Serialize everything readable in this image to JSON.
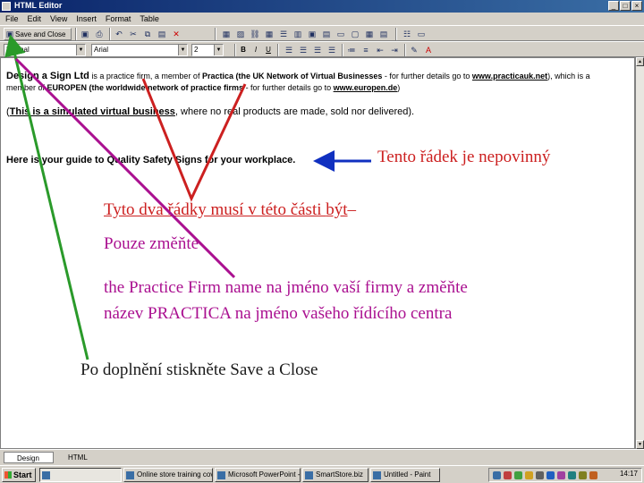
{
  "window": {
    "title": "HTML Editor",
    "buttons": {
      "minimize": "_",
      "maximize": "□",
      "close": "×"
    }
  },
  "menu": [
    "File",
    "Edit",
    "View",
    "Insert",
    "Format",
    "Table"
  ],
  "toolbar1": {
    "save_close_label": "Save and Close"
  },
  "toolbar2": {
    "style_value": "Normal",
    "font_value": "Arial",
    "size_value": "2",
    "bold": "B",
    "italic": "I",
    "underline": "U"
  },
  "document": {
    "para1_company": "Design a Sign Ltd",
    "para1_text1": " is a practice firm, a member of ",
    "para1_practica": "Practica (the UK Network of Virtual Businesses",
    "para1_text2": " - for further details go to ",
    "para1_link1": "www.practicauk.net",
    "para1_text3": "), which is a",
    "para2_text1": "member of ",
    "para2_europen": "EUROPEN (the worldwide network of practice firms",
    "para2_text2": " - for further details go to ",
    "para2_link2": "www.europen.de",
    "para2_text3": ")",
    "para3_open": "(",
    "para3_bold": "This is a simulated virtual business",
    "para3_mid": ", where no real products are made, sold nor delivered",
    "para3_close": ").",
    "guide_line": "Here is your guide to Quality Safety Signs for your workplace."
  },
  "annotations": {
    "optional_note": "Tento řádek je nepovinný",
    "required_prefix": "Tyto dva řádky musí v této části ",
    "required_word": "být",
    "required_suffix": "–",
    "only_change": "Pouze změňte",
    "change_line1": "the Practice Firm name  na jméno vaší firmy a změňte",
    "change_line2": "název PRACTICA  na jméno vašeho řídícího centra",
    "after_fill": "Po doplnění stiskněte Save a Close"
  },
  "view_tabs": {
    "design": "Design",
    "html": "HTML"
  },
  "taskbar": {
    "start": "Start",
    "tasks": [
      "Online store training cov",
      "Microsoft PowerPoint - ...",
      "SmartStore.biz",
      "Untitled - Paint"
    ],
    "clock": "14:17"
  },
  "colors": {
    "annotation_red": "#cc2020",
    "annotation_purple": "#aa1090",
    "arrow_green": "#2a9a2a",
    "arrow_blue": "#1030c0",
    "titlebar": "#0a246a"
  }
}
